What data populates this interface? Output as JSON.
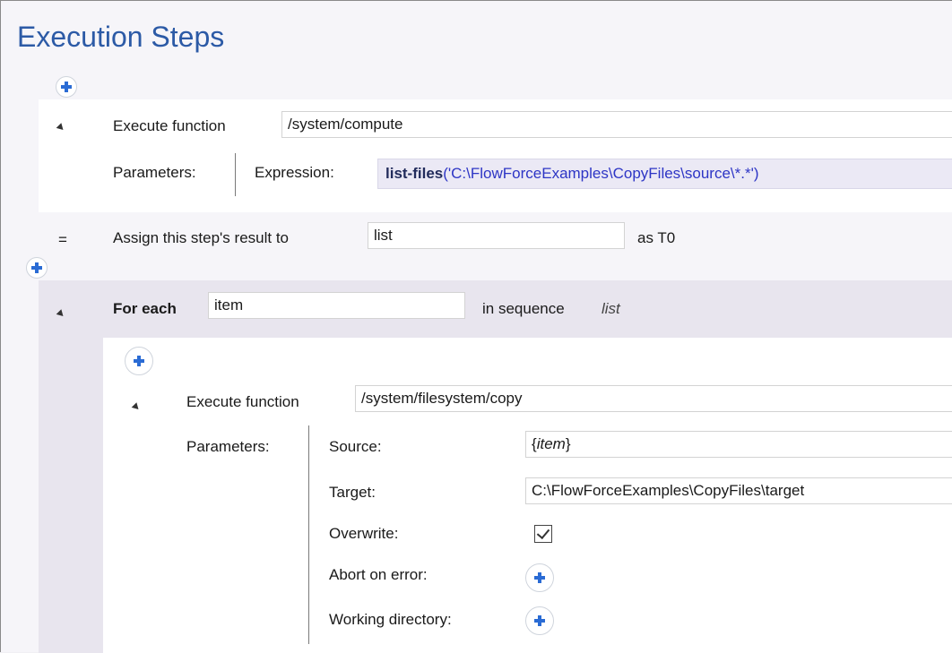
{
  "title": "Execution Steps",
  "step1": {
    "collapse_glyph": "collapse-triangle",
    "label": "Execute function",
    "function_path": "/system/compute",
    "params_label": "Parameters:",
    "expression_label": "Expression:",
    "expression_fn": "list-files",
    "expression_args": "('C:\\FlowForceExamples\\CopyFiles\\source\\*.*')"
  },
  "assign": {
    "marker": "=",
    "label": "Assign this step's result to",
    "value": "list",
    "suffix": "as T0"
  },
  "foreach": {
    "label": "For each",
    "item_value": "item",
    "sequence_label": "in sequence",
    "sequence_value": "list"
  },
  "step2": {
    "label": "Execute function",
    "function_path": "/system/filesystem/copy",
    "params_label": "Parameters:",
    "source_label": "Source:",
    "source_value_prefix": "{",
    "source_value_var": "item",
    "source_value_suffix": "}",
    "target_label": "Target:",
    "target_value": "C:\\FlowForceExamples\\CopyFiles\\target",
    "overwrite_label": "Overwrite:",
    "overwrite_checked": true,
    "abort_label": "Abort on error:",
    "workdir_label": "Working directory:"
  },
  "colors": {
    "title": "#2c5aa6",
    "accent": "#2a6bd4",
    "foreach_band": "#e8e5ee",
    "expression_bg": "#ebe9f5"
  }
}
